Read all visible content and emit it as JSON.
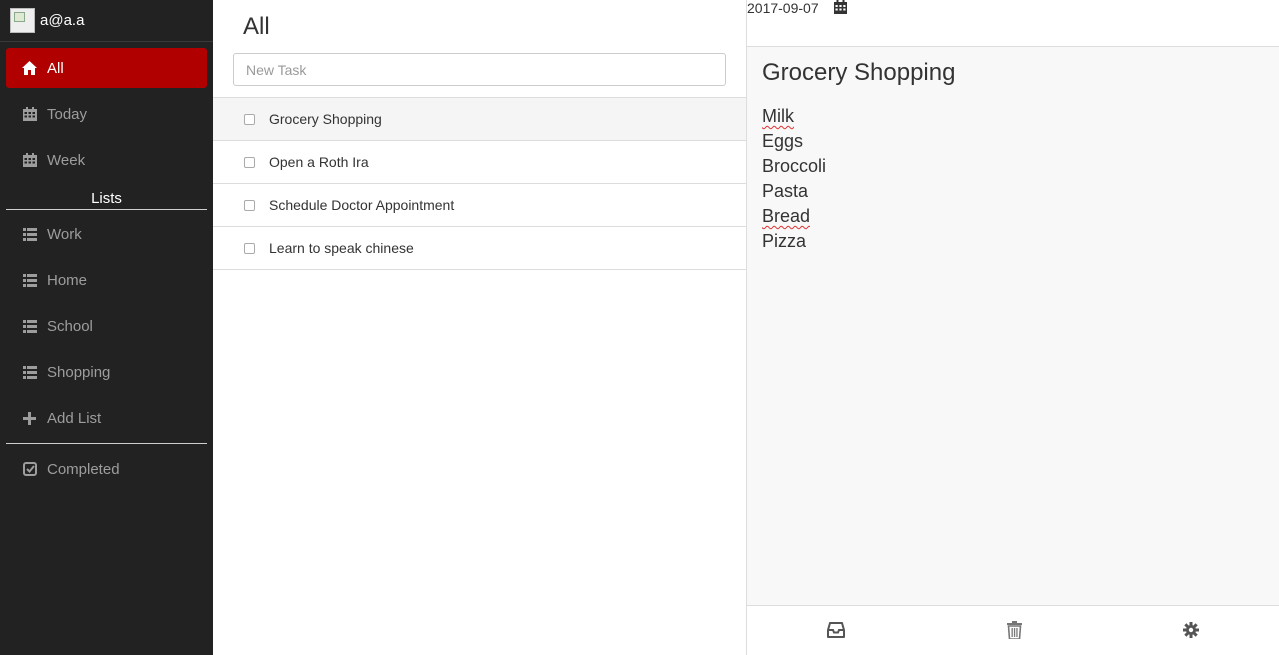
{
  "user": {
    "email": "a@a.a"
  },
  "sidebar": {
    "nav": [
      {
        "label": "All",
        "icon": "home-icon",
        "active": true
      },
      {
        "label": "Today",
        "icon": "calendar-icon"
      },
      {
        "label": "Week",
        "icon": "calendar-icon"
      }
    ],
    "lists_header": "Lists",
    "lists": [
      {
        "label": "Work",
        "icon": "list-icon"
      },
      {
        "label": "Home",
        "icon": "list-icon"
      },
      {
        "label": "School",
        "icon": "list-icon"
      },
      {
        "label": "Shopping",
        "icon": "list-icon"
      }
    ],
    "add_list": "Add List",
    "completed": "Completed"
  },
  "main": {
    "title": "All",
    "new_task_placeholder": "New Task",
    "tasks": [
      {
        "label": "Grocery Shopping",
        "selected": true
      },
      {
        "label": "Open a Roth Ira"
      },
      {
        "label": "Schedule Doctor Appointment"
      },
      {
        "label": "Learn to speak chinese"
      }
    ]
  },
  "detail": {
    "due_date": "2017-09-07",
    "title": "Grocery Shopping",
    "notes": [
      "Milk",
      "Eggs",
      "Broccoli",
      "Pasta",
      "Bread",
      "Pizza"
    ]
  },
  "colors": {
    "accent": "#b00000",
    "sidebar_bg": "#222222"
  }
}
